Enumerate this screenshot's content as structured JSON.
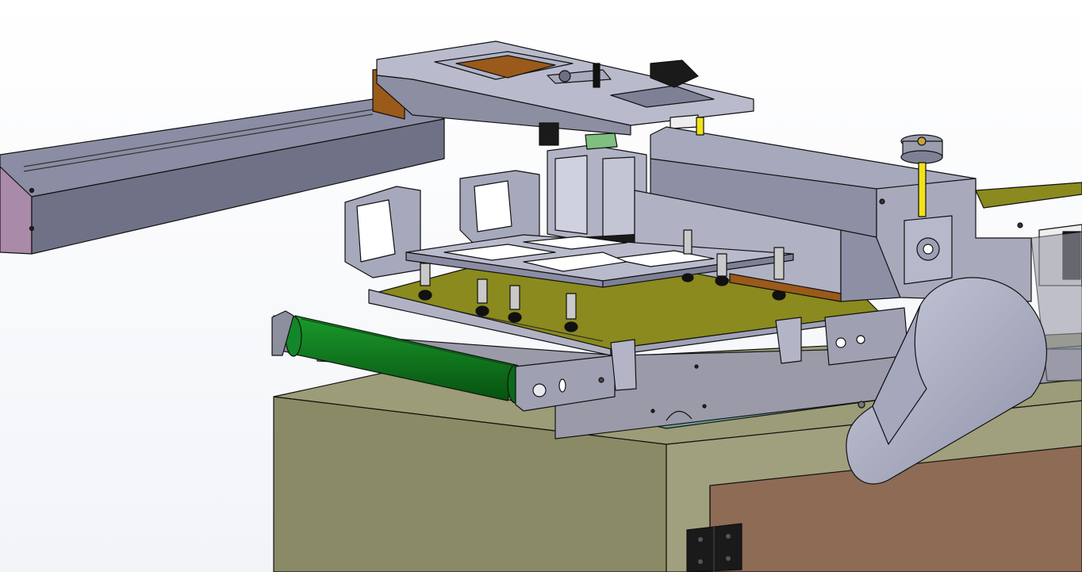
{
  "scene": {
    "view": "isometric-shaded-with-edges",
    "background": {
      "top": "#ffffff",
      "bottom": "#f2f4f8"
    }
  },
  "components": [
    "cabinet-base",
    "cabinet-door",
    "door-hinge",
    "conveyor-belt",
    "conveyor-roller-bracket",
    "tray-plate",
    "suction-plate",
    "vacuum-cups",
    "pneumatic-cylinder",
    "linear-axis-arm",
    "gantry-beam",
    "guide-rail-module",
    "cam-cover",
    "adjust-knob",
    "stepper-motor",
    "support-brackets",
    "side-frame-plate"
  ],
  "colors": {
    "steel": "#9ea1b8",
    "steel_light": "#b9bbcc",
    "steel_dark": "#6f7286",
    "cabinet": "#8a8a66",
    "cabinet_side": "#a0a07e",
    "door": "#8e6b55",
    "belt": "#0d7a1a",
    "belt_dark": "#075d10",
    "tray": "#8a8a1e",
    "copper": "#9a5a1a",
    "yellow_rod": "#f2e21a",
    "black_part": "#1a1a1a",
    "teal_plate": "#6f9e9a",
    "edge": "#111111"
  }
}
